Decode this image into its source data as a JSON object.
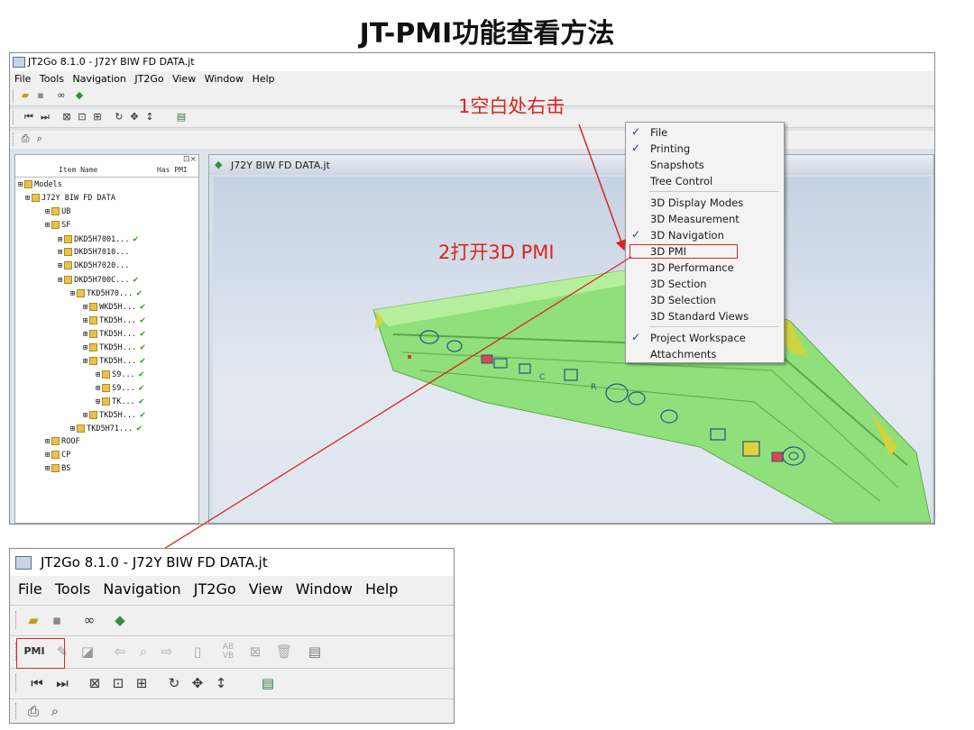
{
  "slide": {
    "title": "JT-PMI功能查看方法"
  },
  "window": {
    "title": "JT2Go 8.1.0 - J72Y BIW FD DATA.jt",
    "menu": [
      "File",
      "Tools",
      "Navigation",
      "JT2Go",
      "View",
      "Window",
      "Help"
    ]
  },
  "tree": {
    "header_item": "Item Name",
    "header_pmi": "Has PMI",
    "rows": [
      {
        "label": "Models",
        "pmi": ""
      },
      {
        "label": "J72Y BIW FD DATA",
        "pmi": ""
      },
      {
        "label": "UB",
        "pmi": ""
      },
      {
        "label": "SF",
        "pmi": ""
      },
      {
        "label": "DKD5H7001...",
        "pmi": "✔"
      },
      {
        "label": "DKD5H7010...",
        "pmi": ""
      },
      {
        "label": "DKD5H7020...",
        "pmi": ""
      },
      {
        "label": "DKD5H700C...",
        "pmi": "✔"
      },
      {
        "label": "TKD5H70...",
        "pmi": "✔"
      },
      {
        "label": "WKD5H...",
        "pmi": "✔"
      },
      {
        "label": "TKD5H...",
        "pmi": "✔"
      },
      {
        "label": "TKD5H...",
        "pmi": "✔"
      },
      {
        "label": "TKD5H...",
        "pmi": "✔"
      },
      {
        "label": "TKD5H...",
        "pmi": "✔"
      },
      {
        "label": "S9...",
        "pmi": "✔"
      },
      {
        "label": "S9...",
        "pmi": "✔"
      },
      {
        "label": "TK...",
        "pmi": "✔"
      },
      {
        "label": "TKD5H...",
        "pmi": "✔"
      },
      {
        "label": "TKD5H71...",
        "pmi": "✔"
      },
      {
        "label": "ROOF",
        "pmi": ""
      },
      {
        "label": "CP",
        "pmi": ""
      },
      {
        "label": "BS",
        "pmi": ""
      }
    ]
  },
  "viewport": {
    "tab_title": "J72Y BIW FD DATA.jt"
  },
  "context_menu": {
    "items": [
      {
        "label": "File",
        "checked": true
      },
      {
        "label": "Printing",
        "checked": true
      },
      {
        "label": "Snapshots",
        "checked": false
      },
      {
        "label": "Tree Control",
        "checked": false
      },
      {
        "label": "3D Display Modes",
        "checked": false
      },
      {
        "label": "3D Measurement",
        "checked": false
      },
      {
        "label": "3D Navigation",
        "checked": true
      },
      {
        "label": "3D PMI",
        "checked": false
      },
      {
        "label": "3D Performance",
        "checked": false
      },
      {
        "label": "3D Section",
        "checked": false
      },
      {
        "label": "3D Selection",
        "checked": false
      },
      {
        "label": "3D Standard Views",
        "checked": false
      },
      {
        "label": "Project Workspace",
        "checked": true
      },
      {
        "label": "Attachments",
        "checked": false
      }
    ]
  },
  "annotations": {
    "step1": "1空白处右击",
    "step2": "2打开3D PMI",
    "color": "#d9261d"
  },
  "zoom_window": {
    "title": "JT2Go 8.1.0 - J72Y BIW FD DATA.jt",
    "menu": [
      "File",
      "Tools",
      "Navigation",
      "JT2Go",
      "View",
      "Window",
      "Help"
    ],
    "pmi_button_label": "PMI"
  },
  "colors": {
    "part_green": "#8fe07a",
    "highlight_red": "#d42a2a"
  }
}
